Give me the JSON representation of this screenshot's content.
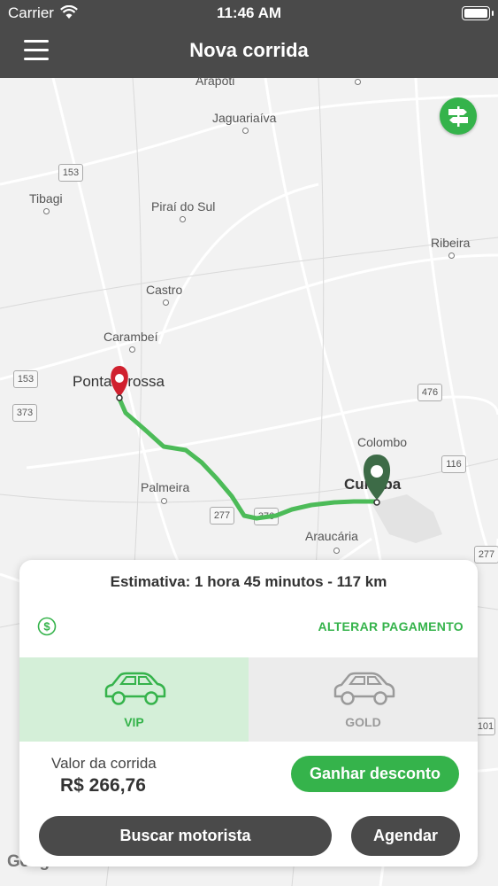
{
  "status_bar": {
    "carrier": "Carrier",
    "time": "11:46 AM"
  },
  "nav": {
    "title": "Nova corrida"
  },
  "map": {
    "places": [
      {
        "name": "Arapoti"
      },
      {
        "name": "Jaguariaíva"
      },
      {
        "name": "Tibagi"
      },
      {
        "name": "Piraí do Sul"
      },
      {
        "name": "Ribeira"
      },
      {
        "name": "Castro"
      },
      {
        "name": "Carambeí"
      },
      {
        "name": "Ponta Grossa"
      },
      {
        "name": "Colombo"
      },
      {
        "name": "Curitiba"
      },
      {
        "name": "Palmeira"
      },
      {
        "name": "Araucária"
      }
    ],
    "shields": [
      "153",
      "153",
      "373",
      "476",
      "116",
      "277",
      "376",
      "277",
      "101"
    ],
    "attribution": "Google",
    "route_color": "#4cbb58",
    "origin_pin_color": "#d0202e",
    "destination_pin_color": "#3d6b47"
  },
  "estimate": {
    "text": "Estimativa: 1 hora 45 minutos - 117 km"
  },
  "payment": {
    "change_label": "ALTERAR PAGAMENTO"
  },
  "categories": [
    {
      "label": "VIP",
      "selected": true
    },
    {
      "label": "GOLD",
      "selected": false
    }
  ],
  "fare": {
    "label": "Valor da corrida",
    "value": "R$ 266,76"
  },
  "buttons": {
    "discount": "Ganhar desconto",
    "search": "Buscar motorista",
    "schedule": "Agendar"
  },
  "colors": {
    "accent": "#35b34b",
    "dark": "#4a4a4a",
    "vip_bg": "#d4efd8",
    "gold_bg": "#ececec"
  }
}
